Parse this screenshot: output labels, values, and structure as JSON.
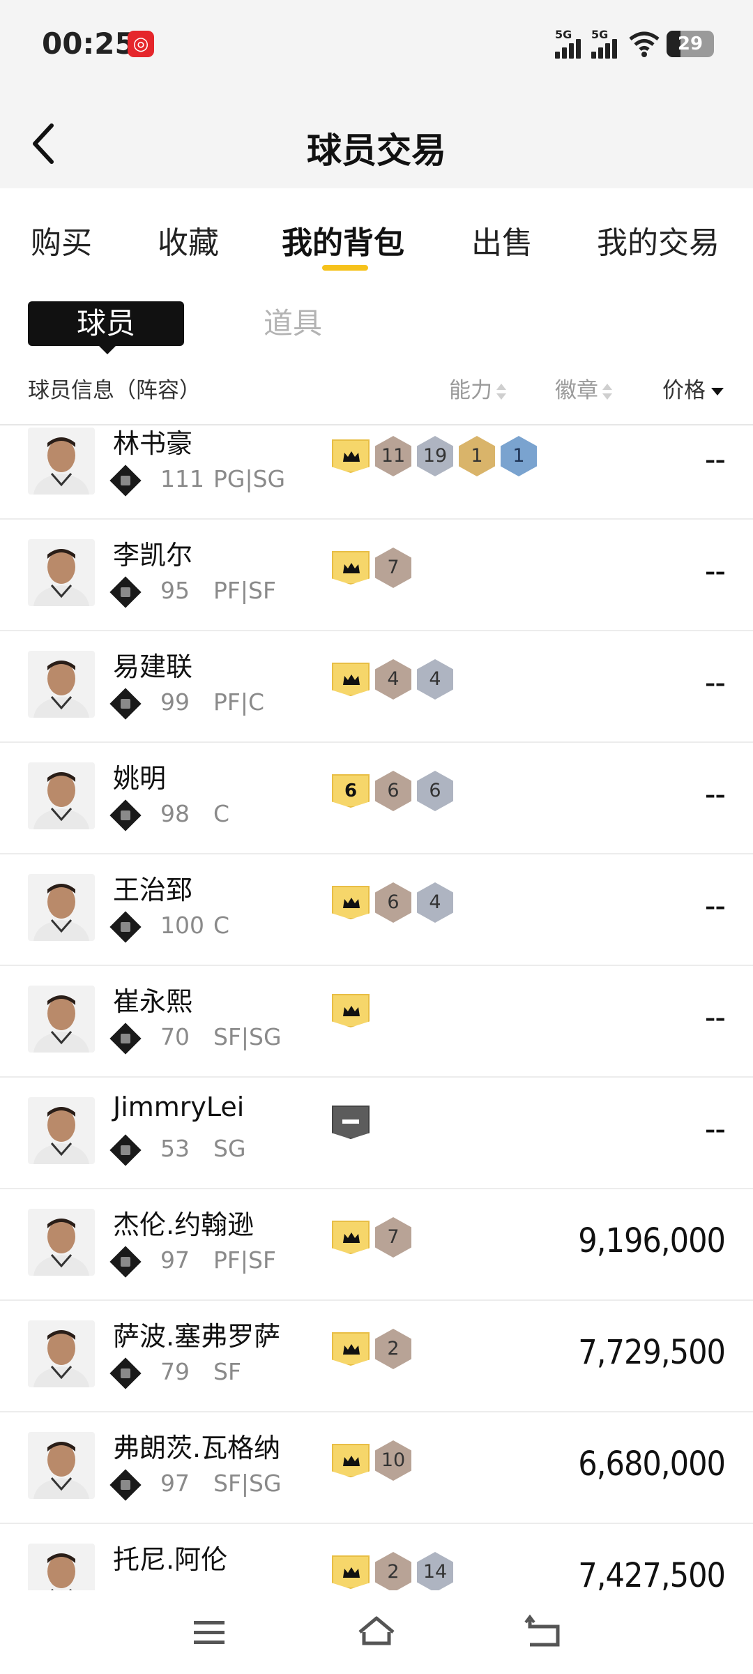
{
  "status": {
    "time": "00:25",
    "signal1": "5G",
    "signal2": "5G",
    "battery": "29"
  },
  "header": {
    "title": "球员交易"
  },
  "tabs": [
    {
      "label": "购买"
    },
    {
      "label": "收藏"
    },
    {
      "label": "我的背包",
      "active": true
    },
    {
      "label": "出售"
    },
    {
      "label": "我的交易"
    }
  ],
  "subtabs": {
    "active": "球员",
    "other": "道具"
  },
  "columns": {
    "info": "球员信息（阵容）",
    "ability": "能力",
    "badge": "徽章",
    "price": "价格"
  },
  "players": [
    {
      "name": "林书豪",
      "ovr": "111",
      "pos": "PG|SG",
      "lead": "crown",
      "badges": [
        {
          "v": "11",
          "c": "bronze"
        },
        {
          "v": "19",
          "c": "silver"
        },
        {
          "v": "1",
          "c": "gold"
        },
        {
          "v": "1",
          "c": "blue"
        }
      ],
      "price": "--"
    },
    {
      "name": "李凯尔",
      "ovr": "95",
      "pos": "PF|SF",
      "lead": "crown",
      "badges": [
        {
          "v": "7",
          "c": "bronze"
        }
      ],
      "price": "--"
    },
    {
      "name": "易建联",
      "ovr": "99",
      "pos": "PF|C",
      "lead": "crown",
      "badges": [
        {
          "v": "4",
          "c": "bronze"
        },
        {
          "v": "4",
          "c": "silver"
        }
      ],
      "price": "--"
    },
    {
      "name": "姚明",
      "ovr": "98",
      "pos": "C",
      "lead": "6",
      "badges": [
        {
          "v": "6",
          "c": "bronze"
        },
        {
          "v": "6",
          "c": "silver"
        }
      ],
      "price": "--"
    },
    {
      "name": "王治郅",
      "ovr": "100",
      "pos": "C",
      "lead": "crown",
      "badges": [
        {
          "v": "6",
          "c": "bronze"
        },
        {
          "v": "4",
          "c": "silver"
        }
      ],
      "price": "--"
    },
    {
      "name": "崔永熙",
      "ovr": "70",
      "pos": "SF|SG",
      "lead": "crown",
      "badges": [],
      "price": "--"
    },
    {
      "name": "JimmryLei",
      "ovr": "53",
      "pos": "SG",
      "lead": "dash",
      "badges": [],
      "price": "--"
    },
    {
      "name": "杰伦.约翰逊",
      "ovr": "97",
      "pos": "PF|SF",
      "lead": "crown",
      "badges": [
        {
          "v": "7",
          "c": "bronze"
        }
      ],
      "price": "9,196,000"
    },
    {
      "name": "萨波.塞弗罗萨",
      "ovr": "79",
      "pos": "SF",
      "lead": "crown",
      "badges": [
        {
          "v": "2",
          "c": "bronze"
        }
      ],
      "price": "7,729,500"
    },
    {
      "name": "弗朗茨.瓦格纳",
      "ovr": "97",
      "pos": "SF|SG",
      "lead": "crown",
      "badges": [
        {
          "v": "10",
          "c": "bronze"
        }
      ],
      "price": "6,680,000"
    },
    {
      "name": "托尼.阿伦",
      "ovr": "",
      "pos": "",
      "lead": "crown",
      "badges": [
        {
          "v": "2",
          "c": "bronze"
        },
        {
          "v": "14",
          "c": "silver"
        }
      ],
      "price": "7,427,500"
    }
  ]
}
